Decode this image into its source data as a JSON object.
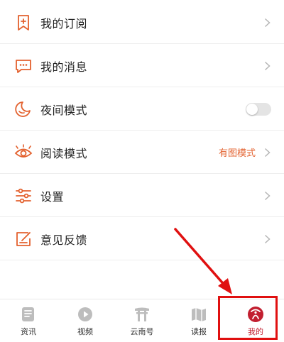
{
  "menu": {
    "items": [
      {
        "label": "我的订阅",
        "icon": "bookmark-plus-icon"
      },
      {
        "label": "我的消息",
        "icon": "message-icon"
      },
      {
        "label": "夜间模式",
        "icon": "moon-icon",
        "toggle_on": false
      },
      {
        "label": "阅读模式",
        "icon": "eye-icon",
        "value": "有图模式"
      },
      {
        "label": "设置",
        "icon": "sliders-icon"
      },
      {
        "label": "意见反馈",
        "icon": "feedback-icon"
      }
    ]
  },
  "tabbar": {
    "tabs": [
      {
        "label": "资讯",
        "icon": "news-icon",
        "active": false
      },
      {
        "label": "视频",
        "icon": "play-icon",
        "active": false
      },
      {
        "label": "云南号",
        "icon": "gate-icon",
        "active": false
      },
      {
        "label": "读报",
        "icon": "map-book-icon",
        "active": false
      },
      {
        "label": "我的",
        "icon": "profile-logo-icon",
        "active": true
      }
    ]
  },
  "colors": {
    "accent_orange": "#e3612e",
    "active_red": "#c21f30",
    "annotation_red": "#e01010",
    "inactive_icon": "#bdbdbd"
  }
}
